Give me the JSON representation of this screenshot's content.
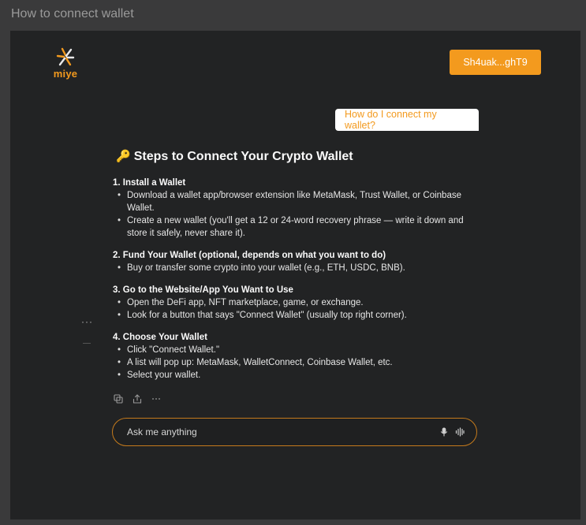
{
  "window": {
    "title": "How to connect wallet"
  },
  "header": {
    "logo_text": "miye",
    "wallet_button_label": "Sh4uak...ghT9"
  },
  "conversation": {
    "user_message": "How do I connect my wallet?",
    "answer": {
      "title": "Steps to Connect Your Crypto Wallet",
      "title_icon": "key-icon",
      "steps": [
        {
          "heading": "1. Install a Wallet",
          "items": [
            "Download a wallet app/browser extension like MetaMask, Trust Wallet, or Coinbase Wallet.",
            "Create a new wallet (you'll get a 12 or 24-word recovery phrase — write it down and store it safely, never share it)."
          ]
        },
        {
          "heading": "2. Fund Your Wallet (optional, depends on what you want to do)",
          "items": [
            "Buy or transfer some crypto into your wallet (e.g., ETH, USDC, BNB)."
          ]
        },
        {
          "heading": "3. Go to the Website/App You Want to Use",
          "items": [
            "Open the DeFi app, NFT marketplace, game, or exchange.",
            "Look for a button that says \"Connect Wallet\" (usually top right corner)."
          ]
        },
        {
          "heading": "4. Choose Your Wallet",
          "items": [
            "Click \"Connect Wallet.\"",
            "A list will pop up: MetaMask, WalletConnect, Coinbase Wallet, etc.",
            "Select your wallet."
          ]
        }
      ]
    },
    "side_menu": "···"
  },
  "input": {
    "placeholder": "Ask me anything"
  },
  "colors": {
    "accent": "#f39a1e",
    "background": "#222324",
    "frame": "#3a3a3b"
  }
}
